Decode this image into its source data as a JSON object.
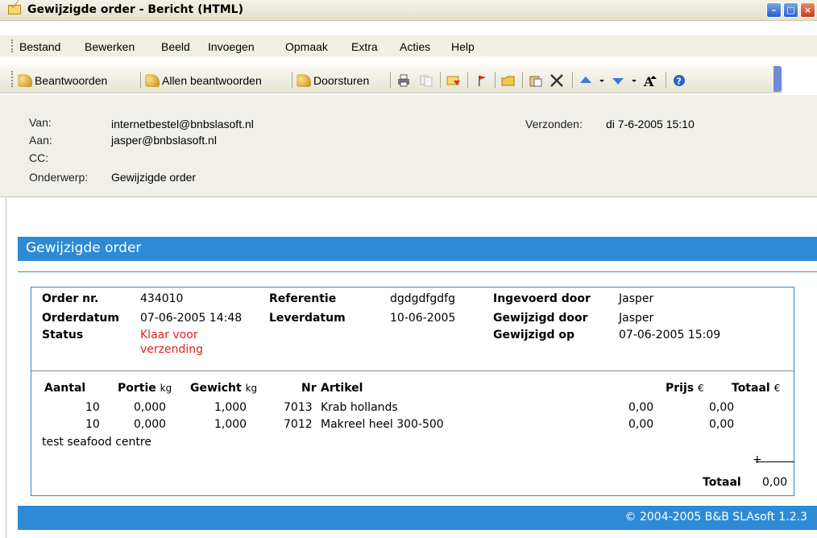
{
  "window": {
    "title": "Gewijzigde order - Bericht (HTML)"
  },
  "menu": [
    "Bestand",
    "Bewerken",
    "Beeld",
    "Invoegen",
    "Opmaak",
    "Extra",
    "Acties",
    "Help"
  ],
  "toolbar": {
    "reply": "Beantwoorden",
    "reply_all": "Allen beantwoorden",
    "forward": "Doorsturen"
  },
  "header": {
    "from_label": "Van:",
    "from_value": "internetbestel@bnbslasoft.nl",
    "to_label": "Aan:",
    "to_value": "jasper@bnbslasoft.nl",
    "cc_label": "CC:",
    "subject_label": "Onderwerp:",
    "subject_value": "Gewijzigde order",
    "sent_label": "Verzonden:",
    "sent_value": "di 7-6-2005 15:10"
  },
  "body": {
    "banner": "Gewijzigde order",
    "order": {
      "order_nr_label": "Order nr.",
      "order_nr": "434010",
      "orderdatum_label": "Orderdatum",
      "orderdatum": "07-06-2005 14:48",
      "status_label": "Status",
      "status_line1": "Klaar voor",
      "status_line2": "verzending",
      "referentie_label": "Referentie",
      "referentie": "dgdgdfgdfg",
      "leverdatum_label": "Leverdatum",
      "leverdatum": "10-06-2005",
      "ingevoerd_label": "Ingevoerd door",
      "ingevoerd": "Jasper",
      "gewijzigd_door_label": "Gewijzigd door",
      "gewijzigd_door": "Jasper",
      "gewijzigd_op_label": "Gewijzigd op",
      "gewijzigd_op": "07-06-2005 15:09"
    },
    "columns": {
      "aantal": "Aantal",
      "portie": "Portie",
      "portie_unit": "kg",
      "gewicht": "Gewicht",
      "gewicht_unit": "kg",
      "nr": "Nr",
      "artikel": "Artikel",
      "prijs": "Prijs",
      "prijs_unit": "€",
      "totaal": "Totaal",
      "totaal_unit": "€"
    },
    "rows": [
      {
        "aantal": "10",
        "portie": "0,000",
        "gewicht": "1,000",
        "nr": "7013",
        "artikel": "Krab hollands",
        "prijs": "0,00",
        "totaal": "0,00"
      },
      {
        "aantal": "10",
        "portie": "0,000",
        "gewicht": "1,000",
        "nr": "7012",
        "artikel": "Makreel heel 300-500",
        "prijs": "0,00",
        "totaal": "0,00"
      }
    ],
    "note": "test seafood centre",
    "total_label": "Totaal",
    "total_value": "0,00",
    "footer": "© 2004-2005 B&B SLAsoft 1.2.3"
  }
}
